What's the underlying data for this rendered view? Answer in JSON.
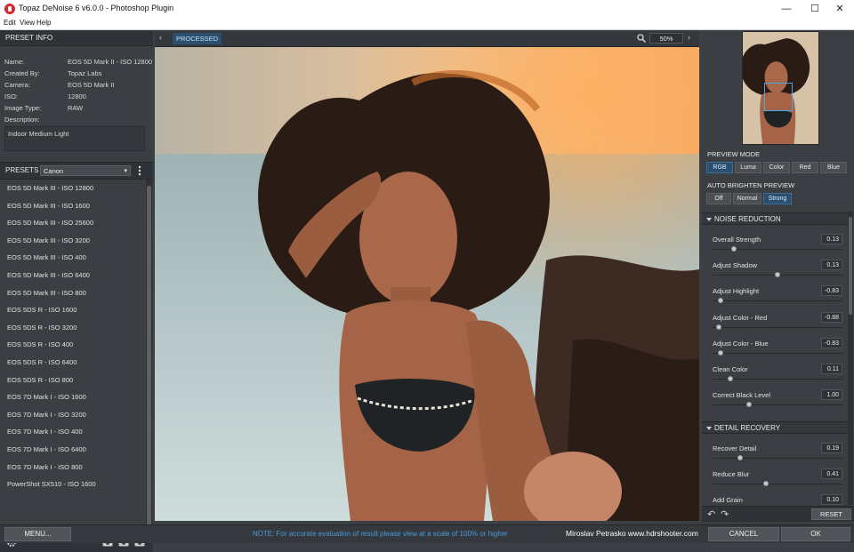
{
  "window": {
    "title": "Topaz DeNoise 6 v6.0.0 - Photoshop Plugin",
    "controls": [
      "—",
      "☐",
      "✕"
    ]
  },
  "menu": [
    "Edit",
    "View",
    "Help"
  ],
  "preset_info": {
    "header": "PRESET INFO",
    "rows": [
      {
        "label": "Name:",
        "value": "EOS 5D Mark II - ISO 12800"
      },
      {
        "label": "Created By:",
        "value": "Topaz Labs"
      },
      {
        "label": "Camera:",
        "value": "EOS 5D Mark II"
      },
      {
        "label": "ISO:",
        "value": "12800"
      },
      {
        "label": "Image Type:",
        "value": "RAW"
      },
      {
        "label": "Description:",
        "value": ""
      }
    ],
    "description": "Indoor Medium Light"
  },
  "presets": {
    "label": "PRESETS",
    "selected": "Canon",
    "items": [
      "EOS 5D Mark III - ISO 12800",
      "EOS 5D Mark III - ISO 1600",
      "EOS 5D Mark III - ISO 25600",
      "EOS 5D Mark III - ISO 3200",
      "EOS 5D Mark III - ISO 400",
      "EOS 5D Mark III - ISO 6400",
      "EOS 5D Mark III - ISO 800",
      "EOS 5DS R - ISO 1600",
      "EOS 5DS R - ISO 3200",
      "EOS 5DS R - ISO 400",
      "EOS 5DS R - ISO 6400",
      "EOS 5DS R - ISO 800",
      "EOS 7D Mark I - ISO 1600",
      "EOS 7D Mark I - ISO 3200",
      "EOS 7D Mark I - ISO 400",
      "EOS 7D Mark I - ISO 6400",
      "EOS 7D Mark I - ISO 800",
      "PowerShot SX510 - ISO 1600"
    ]
  },
  "view": {
    "tab_label": "PROCESSED",
    "zoom": "50%"
  },
  "preview_mode": {
    "label": "PREVIEW MODE",
    "options": [
      "RGB",
      "Luma",
      "Color",
      "Red",
      "Blue"
    ],
    "active": "RGB"
  },
  "auto_brighten": {
    "label": "AUTO BRIGHTEN PREVIEW",
    "options": [
      "Off",
      "Normal",
      "Strong"
    ],
    "active": "Strong"
  },
  "noise_reduction": {
    "title": "NOISE REDUCTION",
    "sliders": [
      {
        "label": "Overall Strength",
        "value": "0.13",
        "position": 0.15
      },
      {
        "label": "Adjust Shadow",
        "value": "0.13",
        "position": 0.5
      },
      {
        "label": "Adjust Highlight",
        "value": "-0.83",
        "position": 0.04
      },
      {
        "label": "Adjust Color - Red",
        "value": "-0.88",
        "position": 0.03
      },
      {
        "label": "Adjust Color - Blue",
        "value": "-0.83",
        "position": 0.04
      },
      {
        "label": "Clean Color",
        "value": "0.11",
        "position": 0.12
      },
      {
        "label": "Correct Black Level",
        "value": "1.00",
        "position": 0.27
      }
    ]
  },
  "detail_recovery": {
    "title": "DETAIL RECOVERY",
    "sliders": [
      {
        "label": "Recover Detail",
        "value": "0.19",
        "position": 0.2
      },
      {
        "label": "Reduce Blur",
        "value": "0.41",
        "position": 0.41
      },
      {
        "label": "Add Grain",
        "value": "0.10",
        "position": 0.1
      }
    ]
  },
  "footer": {
    "menu_button": "MENU...",
    "note": "NOTE:  For accurate evaluation of result please view at a scale of 100% or higher",
    "credit": "Miroslav  Petrasko  www.hdrshooter.com",
    "cancel": "CANCEL",
    "ok": "OK",
    "reset": "RESET"
  },
  "colors": {
    "accent": "#2b4f6d",
    "note_blue": "#4a9bdc",
    "panel": "#3b3e43"
  }
}
